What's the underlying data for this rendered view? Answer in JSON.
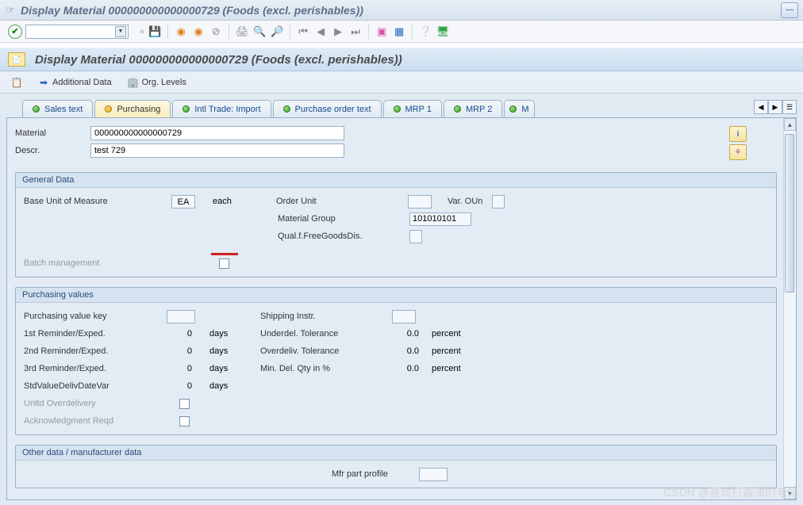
{
  "title": "Display Material 000000000000000729 (Foods (excl. perishables))",
  "subtitle": "Display Material 000000000000000729 (Foods (excl. perishables))",
  "actions": {
    "additional_data": "Additional Data",
    "org_levels": "Org. Levels"
  },
  "tabs": {
    "sales_text": "Sales text",
    "purchasing": "Purchasing",
    "intl_trade": "Intl Trade: Import",
    "po_text": "Purchase order text",
    "mrp1": "MRP 1",
    "mrp2": "MRP 2",
    "more": "M"
  },
  "header": {
    "material_lbl": "Material",
    "material_val": "000000000000000729",
    "descr_lbl": "Descr.",
    "descr_val": "test 729"
  },
  "general_data": {
    "title": "General Data",
    "buom_lbl": "Base Unit of Measure",
    "buom_val": "EA",
    "buom_txt": "each",
    "order_unit_lbl": "Order Unit",
    "var_oun_lbl": "Var. OUn",
    "matgrp_lbl": "Material Group",
    "matgrp_val": "101010101",
    "qual_lbl": "Qual.f.FreeGoodsDis.",
    "batch_lbl": "Batch management"
  },
  "purchasing_values": {
    "title": "Purchasing values",
    "pvk_lbl": "Purchasing value key",
    "ship_lbl": "Shipping Instr.",
    "r1_lbl": "1st Reminder/Exped.",
    "r2_lbl": "2nd Reminder/Exped.",
    "r3_lbl": "3rd Reminder/Exped.",
    "std_lbl": "StdValueDelivDateVar",
    "r_val": "0",
    "days": "days",
    "under_lbl": "Underdel. Tolerance",
    "over_lbl": "Overdeliv. Tolerance",
    "min_lbl": "Min. Del. Qty in %",
    "tol_val": "0.0",
    "percent": "percent",
    "unltd_lbl": "Unltd Overdelivery",
    "ack_lbl": "Acknowledgment Reqd"
  },
  "other_data": {
    "title": "Other data / manufacturer data",
    "mfr_lbl": "Mfr part profile"
  },
  "watermark": "CSDN @喜欢打酱油的老鸟"
}
